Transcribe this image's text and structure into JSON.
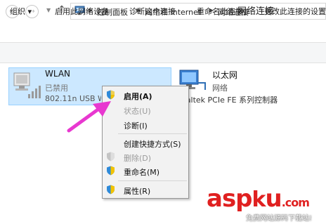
{
  "window": {
    "title": "网络连接"
  },
  "address": {
    "crumbs": [
      "控制面板",
      "网络和 Internet",
      "网络连接"
    ]
  },
  "toolbar": {
    "items": [
      "组织 ▾",
      "启用此网络设备",
      "诊断这个连接",
      "重命名此连接",
      "更改此连接的设置"
    ]
  },
  "connections": [
    {
      "name": "WLAN",
      "status": "已禁用",
      "device": "802.11n USB W"
    },
    {
      "name": "以太网",
      "status": "网络",
      "device": "ealtek PCIe FE 系列控制器"
    }
  ],
  "context_menu": {
    "items": [
      {
        "label": "启用(A)",
        "icon": "shield-icon",
        "state": "default"
      },
      {
        "label": "状态(U)",
        "icon": "",
        "state": "disabled"
      },
      {
        "label": "诊断(I)",
        "icon": "",
        "state": "normal"
      },
      {
        "label": "创建快捷方式(S)",
        "icon": "",
        "state": "normal"
      },
      {
        "label": "删除(D)",
        "icon": "shield-icon",
        "state": "disabled"
      },
      {
        "label": "重命名(M)",
        "icon": "shield-icon",
        "state": "normal"
      },
      {
        "label": "属性(R)",
        "icon": "shield-icon",
        "state": "normal"
      }
    ]
  },
  "watermark": {
    "logo_text": "asp ku .com",
    "subtitle": "免费网站源码下载站!"
  },
  "colors": {
    "selection": "#cce8ff",
    "arrow": "#e838d0",
    "watermark": "#e02020"
  }
}
